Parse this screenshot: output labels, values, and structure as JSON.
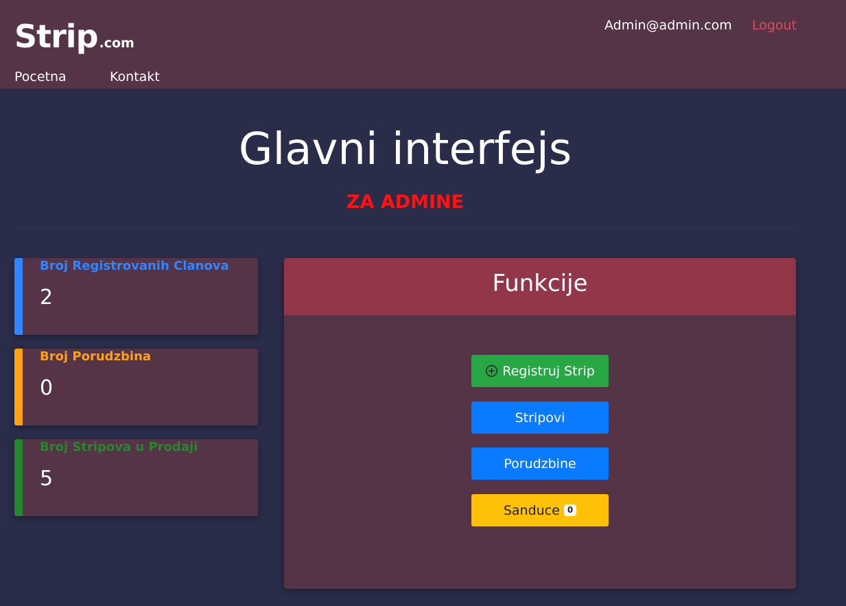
{
  "header": {
    "brand_main": "Strip",
    "brand_suffix": ".com",
    "nav": [
      {
        "label": "Pocetna"
      },
      {
        "label": "Kontakt"
      }
    ],
    "user_email": "Admin@admin.com",
    "logout_label": "Logout"
  },
  "hero": {
    "title": "Glavni interfejs",
    "subtitle": "ZA ADMINE"
  },
  "stats": [
    {
      "label": "Broj Registrovanih Clanova",
      "value": "2",
      "color": "#2f86ff"
    },
    {
      "label": "Broj Porudzbina",
      "value": "0",
      "color": "#ffa113"
    },
    {
      "label": "Broj Stripova u Prodaji",
      "value": "5",
      "color": "#25882e"
    }
  ],
  "panel": {
    "title": "Funkcije",
    "buttons": {
      "register": "Registruj Strip",
      "comics": "Stripovi",
      "orders": "Porudzbine",
      "inbox": "Sanduce",
      "inbox_count": "0"
    }
  },
  "colors": {
    "page_bg": "#2a2d4a",
    "header_bg": "#553448",
    "panel_header_bg": "#923649",
    "logout": "#e4485e",
    "subtitle": "#ff1212"
  },
  "icons": {
    "register_button_icon": "plus-circle-icon"
  }
}
